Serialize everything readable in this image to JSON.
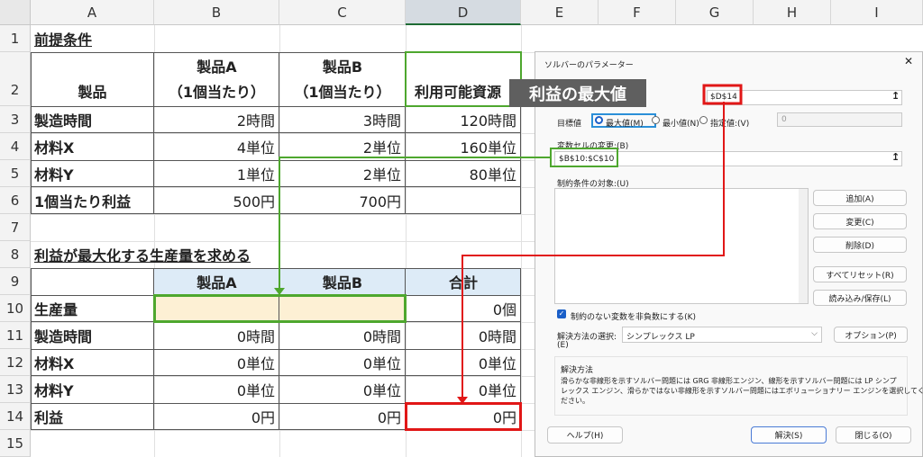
{
  "sheet": {
    "columns": [
      "A",
      "B",
      "C",
      "D",
      "E",
      "F",
      "G",
      "H",
      "I"
    ],
    "rows": [
      "1",
      "2",
      "3",
      "4",
      "5",
      "6",
      "7",
      "8",
      "9",
      "10",
      "11",
      "12",
      "13",
      "14",
      "15"
    ],
    "a1": "前提条件",
    "h_product": "製品",
    "h_a": "製品A",
    "h_a_sub": "（1個当たり）",
    "h_b": "製品B",
    "h_b_sub": "（1個当たり）",
    "h_res": "利用可能資源",
    "r3": [
      "製造時間",
      "2時間",
      "3時間",
      "120時間"
    ],
    "r4": [
      "材料X",
      "4単位",
      "2単位",
      "160単位"
    ],
    "r5": [
      "材料Y",
      "1単位",
      "2単位",
      "80単位"
    ],
    "r6": [
      "1個当たり利益",
      "500円",
      "700円"
    ],
    "a8": "利益が最大化する生産量を求める",
    "r9": [
      "製品A",
      "製品B",
      "合計"
    ],
    "r10": [
      "生産量",
      "0個"
    ],
    "r11": [
      "製造時間",
      "0時間",
      "0時間",
      "0時間"
    ],
    "r12": [
      "材料X",
      "0単位",
      "0単位",
      "0単位"
    ],
    "r13": [
      "材料Y",
      "0単位",
      "0単位",
      "0単位"
    ],
    "r14": [
      "利益",
      "0円",
      "0円",
      "0円"
    ]
  },
  "annotation": {
    "label": "利益の最大値"
  },
  "colors": {
    "green": "#4ea72e",
    "red": "#e11717",
    "blue": "#2a8fd8",
    "yellow_fill": "#fdf0d4",
    "blue_fill": "#ddebf7"
  },
  "dialog": {
    "title": "ソルバーのパラメーター",
    "close": "✕",
    "objective_value": "$D$14",
    "goal_label": "目標値",
    "opt_max": "最大値(M)",
    "opt_min": "最小値(N)",
    "opt_value": "指定値:(V)",
    "value_field": "0",
    "vars_label": "変数セルの変更:(B)",
    "vars_value": "$B$10:$C$10",
    "constraints_label": "制約条件の対象:(U)",
    "btn_add": "追加(A)",
    "btn_change": "変更(C)",
    "btn_delete": "削除(D)",
    "btn_reset": "すべてリセット(R)",
    "btn_load": "読み込み/保存(L)",
    "nonneg_label": "制約のない変数を非負数にする(K)",
    "method_label": "解決方法の選択:",
    "method_label2": "(E)",
    "method_value": "シンプレックス LP",
    "btn_options": "オプション(P)",
    "method_group_title": "解決方法",
    "method_desc1": "滑らかな非線形を示すソルバー問題には GRG 非線形エンジン、線形を示すソルバー問題には LP シンプ",
    "method_desc2": "レックス エンジン、滑らかではない非線形を示すソルバー問題にはエボリューショナリー エンジンを選択してく",
    "method_desc3": "ださい。",
    "btn_help": "ヘルプ(H)",
    "btn_solve": "解決(S)",
    "btn_close": "閉じる(O)",
    "collapse_icon": "↥"
  }
}
